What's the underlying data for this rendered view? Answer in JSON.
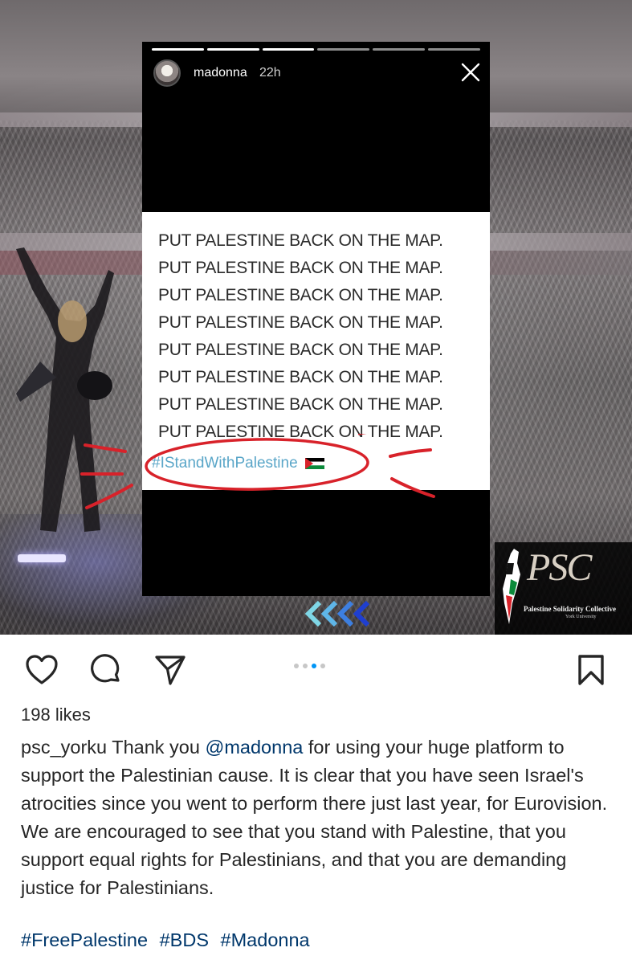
{
  "story": {
    "username": "madonna",
    "time": "22h",
    "lines": [
      "PUT PALESTINE BACK ON THE MAP.",
      "PUT PALESTINE BACK ON THE MAP.",
      "PUT PALESTINE BACK ON THE MAP.",
      "PUT PALESTINE BACK ON THE MAP.",
      "PUT PALESTINE BACK ON THE MAP.",
      "PUT PALESTINE BACK ON THE MAP.",
      "PUT PALESTINE BACK ON THE MAP.",
      "PUT PALESTINE BACK ON THE MAP."
    ],
    "hashtag": "#IStandWithPalestine",
    "flag_icon": "palestine-flag-icon",
    "annotation_color": "#d8222a"
  },
  "logo": {
    "letters": "PSC",
    "name": "Palestine Solidarity Collective",
    "sub": "York University"
  },
  "actions": {
    "like_icon": "heart-icon",
    "comment_icon": "comment-icon",
    "share_icon": "send-icon",
    "save_icon": "bookmark-icon",
    "carousel_count": 4,
    "carousel_active": 3,
    "accent": "#0095f6"
  },
  "post": {
    "likes": "198 likes",
    "author": "psc_yorku",
    "caption_part1": " Thank you ",
    "mention": "@madonna",
    "caption_part2": " for using your huge platform to support the Palestinian cause. It is clear that you have seen Israel's atrocities since you went to perform there just last year, for Eurovision. We are encouraged to see that you stand with Palestine, that you support equal rights for Palestinians, and that you are demanding justice for Palestinians.",
    "hashtags": [
      "#FreePalestine",
      "#BDS",
      "#Madonna"
    ],
    "link_color": "#00376b"
  }
}
